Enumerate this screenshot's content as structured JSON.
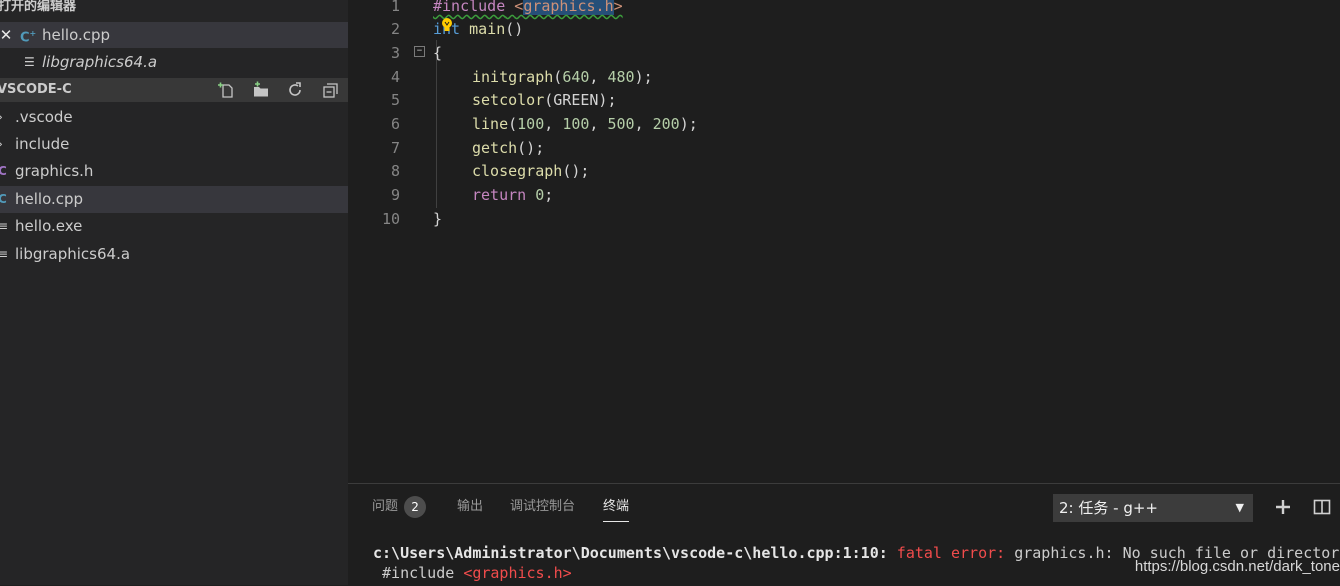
{
  "sidebar": {
    "open_editors_title": "打开的编辑器",
    "open_editors": [
      {
        "name": "hello.cpp",
        "icon": "cpp-file-icon",
        "active": true
      },
      {
        "name": "libgraphics64.a",
        "icon": "file-lines-icon",
        "italic": true
      }
    ],
    "folder_name": "VSCODE-C",
    "toolbar_icons": [
      "new-file-icon",
      "new-folder-icon",
      "refresh-icon",
      "collapse-all-icon"
    ],
    "tree": [
      {
        "name": ".vscode",
        "glyph": "›",
        "icon": "chevron-right-icon"
      },
      {
        "name": "include",
        "glyph": "›",
        "icon": "chevron-right-icon"
      },
      {
        "name": "graphics.h",
        "glyph": "C",
        "icon": "c-file-icon"
      },
      {
        "name": "hello.cpp",
        "glyph": "C",
        "icon": "cpp-file-icon",
        "selected": true
      },
      {
        "name": "hello.exe",
        "glyph": "≡",
        "icon": "file-lines-icon"
      },
      {
        "name": "libgraphics64.a",
        "glyph": "≡",
        "icon": "file-lines-icon"
      }
    ]
  },
  "editor": {
    "line_numbers": [
      "1",
      "2",
      "3",
      "4",
      "5",
      "6",
      "7",
      "8",
      "9",
      "10"
    ],
    "lines": {
      "l1": {
        "directive": "#include",
        "sp": " ",
        "open": "<",
        "header": "graphics.h",
        "close": ">"
      },
      "l2": {
        "kw": "int",
        "sp": " ",
        "fn": "main",
        "rest": "()"
      },
      "l3": {
        "text": "{"
      },
      "l4": {
        "fn": "initgraph",
        "p1": "(",
        "n1": "640",
        "c1": ", ",
        "n2": "480",
        "p2": ");"
      },
      "l5": {
        "fn": "setcolor",
        "rest": "(GREEN);"
      },
      "l6": {
        "fn": "line",
        "p1": "(",
        "n1": "100",
        "c1": ", ",
        "n2": "100",
        "c2": ", ",
        "n3": "500",
        "c3": ", ",
        "n4": "200",
        "p2": ");"
      },
      "l7": {
        "fn": "getch",
        "rest": "();"
      },
      "l8": {
        "fn": "closegraph",
        "rest": "();"
      },
      "l9": {
        "kw": "return",
        "sp": " ",
        "num": "0",
        "rest": ";"
      },
      "l10": {
        "text": "}"
      }
    }
  },
  "panel": {
    "tabs": [
      {
        "label": "问题",
        "badge": "2"
      },
      {
        "label": "输出"
      },
      {
        "label": "调试控制台"
      },
      {
        "label": "终端",
        "active": true
      }
    ],
    "task_selector": {
      "value": "2: 任务 - g++",
      "caret": "▼"
    },
    "icons": [
      "add-icon",
      "split-icon"
    ],
    "terminal": {
      "line1_path": "c:\\Users\\Administrator\\Documents\\vscode-c\\hello.cpp:1:10:",
      "line1_error": "fatal error:",
      "line1_msg": "graphics.h: No such file or directory",
      "line2_prefix": " #include ",
      "line2_header": "<graphics.h>"
    }
  },
  "watermark": "https://blog.csdn.net/dark_tone",
  "colors": {
    "accent_blue": "#519aba",
    "error_red": "#f14c4c",
    "background": "#1e1e1e",
    "sidebar": "#252526"
  }
}
